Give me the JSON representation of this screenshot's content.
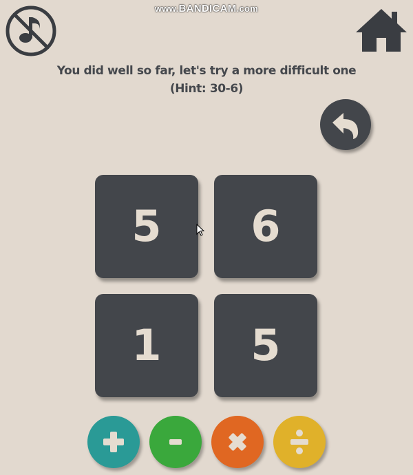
{
  "watermark": {
    "prefix": "www.",
    "brand": "BANDICAM",
    "suffix": ".com"
  },
  "controls": {
    "mute_icon": "music-off-icon",
    "home_icon": "home-icon",
    "undo_icon": "undo-arrow-icon"
  },
  "message": {
    "line1": "You did well so far, let's try a more difficult one",
    "line2": "(Hint: 30-6)"
  },
  "tiles": [
    {
      "value": "5"
    },
    {
      "value": "6"
    },
    {
      "value": "1"
    },
    {
      "value": "5"
    }
  ],
  "operators": [
    {
      "name": "plus",
      "icon": "plus-icon",
      "color": "#2a9a96"
    },
    {
      "name": "minus",
      "icon": "minus-icon",
      "color": "#3aa83c"
    },
    {
      "name": "times",
      "icon": "times-icon",
      "color": "#e06722"
    },
    {
      "name": "divide",
      "icon": "divide-icon",
      "color": "#e0b12a"
    }
  ],
  "colors": {
    "background": "#e2d9cf",
    "tile": "#43464b",
    "tile_text": "#e5dcd0",
    "text": "#45484d"
  }
}
